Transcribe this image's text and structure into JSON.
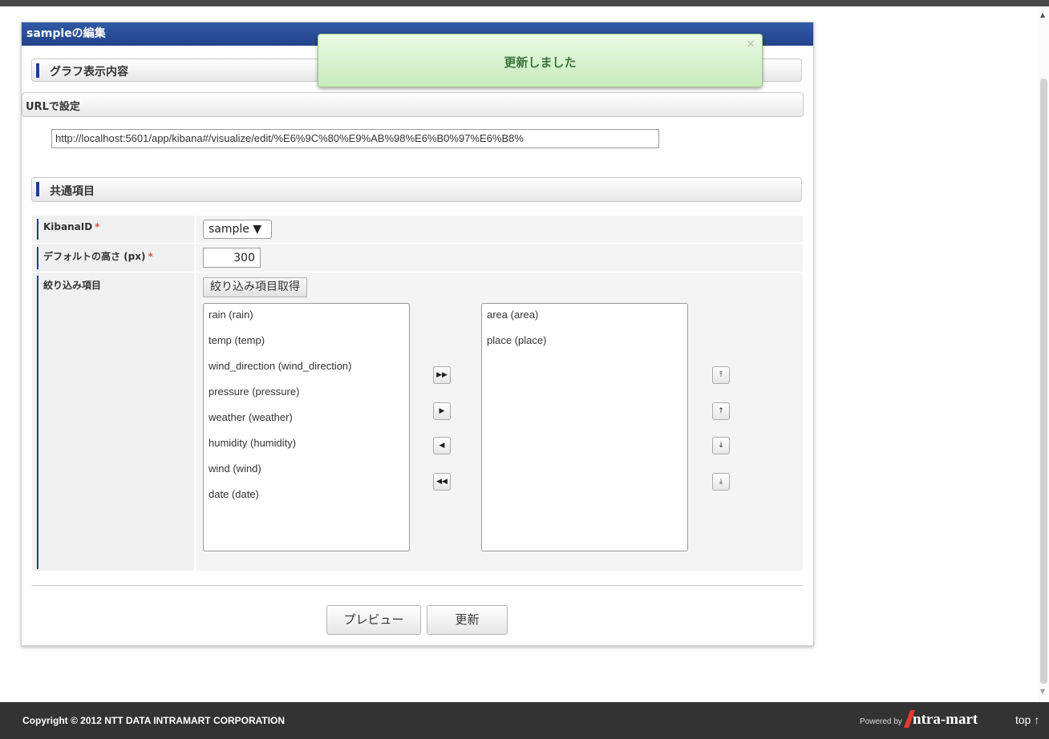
{
  "panel": {
    "title": "sampleの編集",
    "section_graph": "グラフ表示内容",
    "url_section": "URLで設定",
    "url_value": "http://localhost:5601/app/kibana#/visualize/edit/%E6%9C%80%E9%AB%98%E6%B0%97%E6%B8%",
    "section_common": "共通項目"
  },
  "form": {
    "kibana_label": "KibanaID",
    "kibana_required": "*",
    "kibana_value": "sample ▼",
    "height_label": "デフォルトの高さ (px)",
    "height_required": "*",
    "height_value": "300",
    "filter_label": "絞り込み項目",
    "filter_fetch_button": "絞り込み項目取得",
    "available_items": [
      "rain (rain)",
      "temp (temp)",
      "wind_direction (wind_direction)",
      "pressure (pressure)",
      "weather (weather)",
      "humidity (humidity)",
      "wind (wind)",
      "date (date)"
    ],
    "selected_items": [
      "area (area)",
      "place (place)"
    ],
    "move_buttons": [
      "move-all-right-icon",
      "move-right-icon",
      "move-left-icon",
      "move-all-left-icon"
    ],
    "order_buttons": [
      "move-top-icon",
      "move-up-icon",
      "move-down-icon",
      "move-bottom-icon"
    ]
  },
  "actions": {
    "preview": "プレビュー",
    "update": "更新"
  },
  "toast": {
    "message": "更新しました",
    "close": "×"
  },
  "footer": {
    "copyright": "Copyright © 2012 NTT DATA INTRAMART CORPORATION",
    "powered_by": "Powered by",
    "logo": "ntra-mart",
    "top_link": "top ↑"
  }
}
